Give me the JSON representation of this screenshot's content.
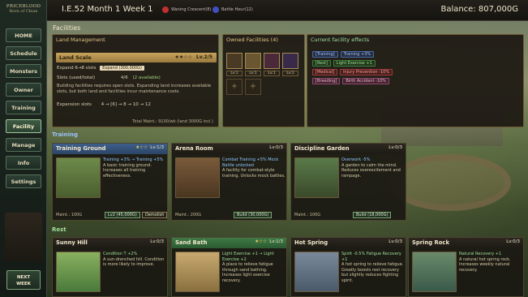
{
  "topbar": {
    "date": "I.E.52 Month 1 Week 1",
    "indicator1": "Waning Crescent(8)",
    "indicator2": "Battle Hour(12)",
    "balance": "Balance: 807,000G"
  },
  "sidebar": {
    "logo_line1": "PRICEBLOOD",
    "logo_line2": "Born of Clean",
    "items": [
      "HOME",
      "Schedule",
      "Monsters",
      "Owner",
      "Training",
      "Facility",
      "Manage",
      "Info",
      "Settings"
    ],
    "active": "Facility",
    "next_week": [
      "NEXT",
      "WEEK"
    ]
  },
  "facilities": {
    "title": "Facilities",
    "land": {
      "header": "Land Management",
      "name": "Land Scale",
      "stars": "★★☆☆",
      "level": "Lv.2/5",
      "expand_text": "Expand 6→8 slots",
      "expand_button": "Expand (300,000G)",
      "slots_label": "Slots (used/total)",
      "slots_value": "4/6",
      "slots_available": "(2 available)",
      "desc": "Building facilities requires open slots. Expanding land increases available slots, but both land and facilities incur maintenance costs.",
      "exp_slots_label": "Expansion slots",
      "exp_slots_value": "4 → [6] → 8 → 10 → 12",
      "total_maint": "Total Maint.: 9100/wk (land 3000G incl.)"
    },
    "owned": {
      "header": "Owned Facilities (4)",
      "levels": [
        "Lv:1",
        "Lv:1",
        "Lv:1",
        "Lv:1"
      ],
      "empty": [
        "+",
        "+"
      ]
    },
    "effects": {
      "header": "Current facility effects",
      "rows": [
        {
          "label": "[Training]",
          "value": "Training +3%"
        },
        {
          "label": "[Rest]",
          "value": "Light Exercise +1"
        },
        {
          "label": "[Medical]",
          "value": "Injury Prevention -10%"
        },
        {
          "label": "[Breeding]",
          "value": "Birth Accident -10%"
        }
      ]
    }
  },
  "training": {
    "header": "Training",
    "cards": [
      {
        "name": "Training Ground",
        "stars": "★☆☆",
        "level": "Lv:1/3",
        "effect": "Training +3% → Training +5%",
        "desc": "A basic training ground. Increases all training effectiveness.",
        "maint": "Maint.: 100G",
        "btn1": "Lv2 (45,000G)",
        "btn2": "Demolish"
      },
      {
        "name": "Arena Room",
        "stars": "",
        "level": "Lv:0/3",
        "effect": "Combat Training +5% Mock Battle unlocked",
        "desc": "A facility for combat-style training. Unlocks mock battles.",
        "maint": "Maint.: 200G",
        "btn1": "Build (30,000G)",
        "btn2": ""
      },
      {
        "name": "Discipline Garden",
        "stars": "",
        "level": "Lv:0/3",
        "effect": "Overwork -5%",
        "desc": "A garden to calm the mind. Reduces overexcitement and rampage.",
        "maint": "Maint.: 100G",
        "btn1": "Build (18,000G)",
        "btn2": ""
      }
    ]
  },
  "rest": {
    "header": "Rest",
    "cards": [
      {
        "name": "Sunny Hill",
        "stars": "",
        "level": "Lv:0/3",
        "effect": "Condition T +2%",
        "desc": "A sun-drenched hill. Condition is more likely to improve."
      },
      {
        "name": "Sand Bath",
        "stars": "★☆☆",
        "level": "Lv:1/3",
        "effect": "Light Exercise +1 → Light Exercise +2",
        "desc": "A place to relieve fatigue through sand bathing. Increases light exercise recovery."
      },
      {
        "name": "Hot Spring",
        "stars": "",
        "level": "Lv:0/3",
        "effect": "Spirit -0.5% Fatigue Recovery +1",
        "desc": "A hot spring to relieve fatigue. Greatly boosts rest recovery but slightly reduces fighting spirit."
      },
      {
        "name": "Spring Rock",
        "stars": "",
        "level": "Lv:0/3",
        "effect": "Natural Recovery +1",
        "desc": "A natural hot spring rock. Increases weekly natural recovery."
      }
    ]
  }
}
